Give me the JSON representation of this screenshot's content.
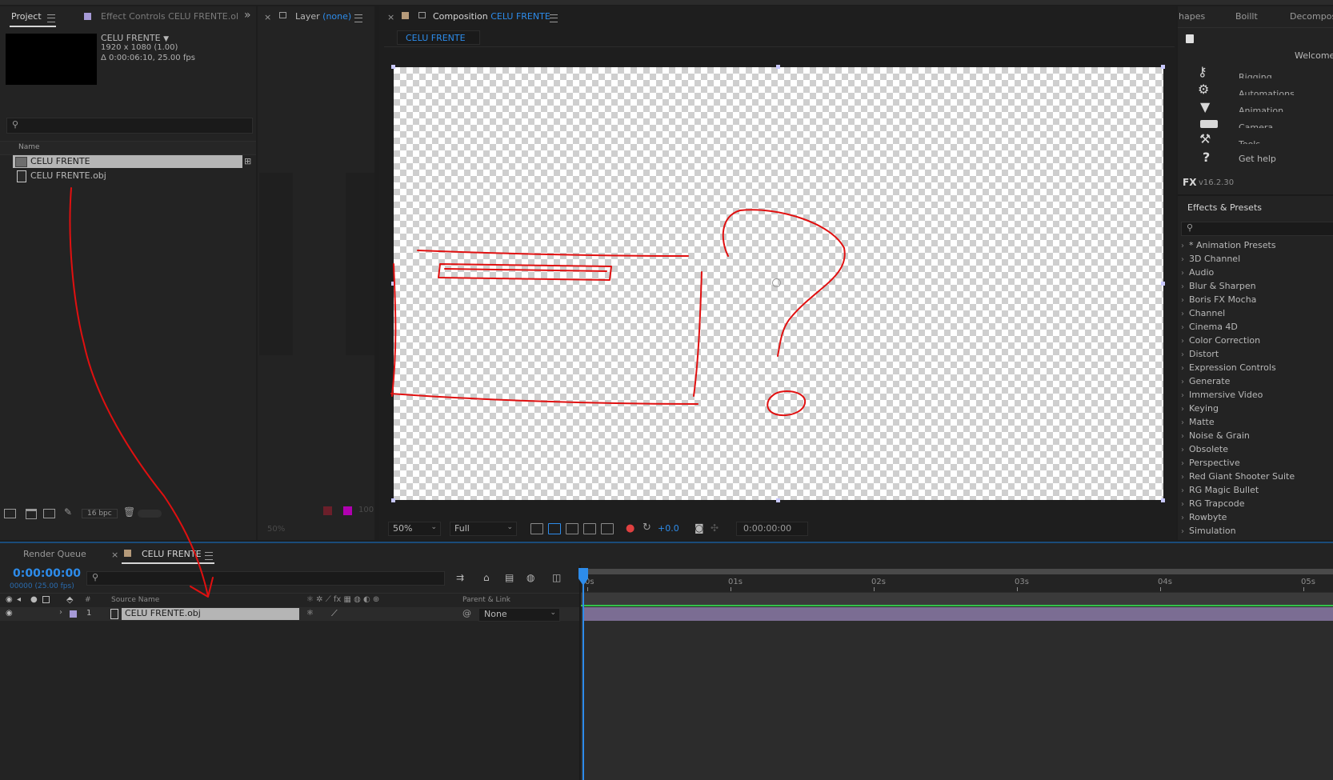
{
  "project_panel": {
    "tab_label": "Project",
    "effect_controls_tab": "Effect Controls",
    "effect_controls_target": "CELU FRENTE.ol",
    "comp_info": {
      "name": "CELU FRENTE",
      "resolution": "1920 x 1080 (1.00)",
      "duration": "Δ 0:00:06:10, 25.00 fps"
    },
    "column_name": "Name",
    "items": [
      {
        "name": "CELU FRENTE",
        "type": "composition"
      },
      {
        "name": "CELU FRENTE.obj",
        "type": "3d-object"
      }
    ],
    "bpc_label": "16 bpc"
  },
  "layer_panel": {
    "tab_label": "Layer",
    "layer_value": "(none)",
    "zoom_ghost": "50%",
    "value_ghost": "100"
  },
  "composition_panel": {
    "tab_label": "Composition",
    "comp_name": "CELU FRENTE",
    "breadcrumb": "CELU FRENTE",
    "zoom": "50%",
    "resolution": "Full",
    "exposure": "+0.0",
    "timecode": "0:00:00:00"
  },
  "right_panel": {
    "tabs": [
      "hapes",
      "Boillt",
      "Decompos"
    ],
    "welcome_label": "Welcome",
    "menu": [
      {
        "label": "Rigging",
        "icon": "key-icon"
      },
      {
        "label": "Automations",
        "icon": "gears-icon"
      },
      {
        "label": "Animation",
        "icon": "funnel-icon"
      },
      {
        "label": "Camera",
        "icon": "camera-icon"
      },
      {
        "label": "Tools",
        "icon": "tools-icon"
      },
      {
        "label": "Get help",
        "icon": "question-icon"
      }
    ],
    "version": "v16.2.30",
    "effects_title": "Effects & Presets",
    "effects": [
      "* Animation Presets",
      "3D Channel",
      "Audio",
      "Blur & Sharpen",
      "Boris FX Mocha",
      "Channel",
      "Cinema 4D",
      "Color Correction",
      "Distort",
      "Expression Controls",
      "Generate",
      "Immersive Video",
      "Keying",
      "Matte",
      "Noise & Grain",
      "Obsolete",
      "Perspective",
      "Red Giant Shooter Suite",
      "RG Magic Bullet",
      "RG Trapcode",
      "Rowbyte",
      "Simulation"
    ]
  },
  "timeline": {
    "render_queue_tab": "Render Queue",
    "comp_tab": "CELU FRENTE",
    "timecode": "0:00:00:00",
    "frame_info": "00000 (25.00 fps)",
    "col_number": "#",
    "col_source_name": "Source Name",
    "col_parent": "Parent & Link",
    "layer": {
      "index": "1",
      "name": "CELU FRENTE.obj",
      "parent": "None"
    },
    "ruler": [
      "0s",
      "01s",
      "02s",
      "03s",
      "04s",
      "05s"
    ]
  },
  "colors": {
    "accent_blue": "#2d8ceb",
    "annotation_red": "#e01010",
    "layer_bar": "#7b6d93",
    "label_lavender": "#a69ad6"
  }
}
